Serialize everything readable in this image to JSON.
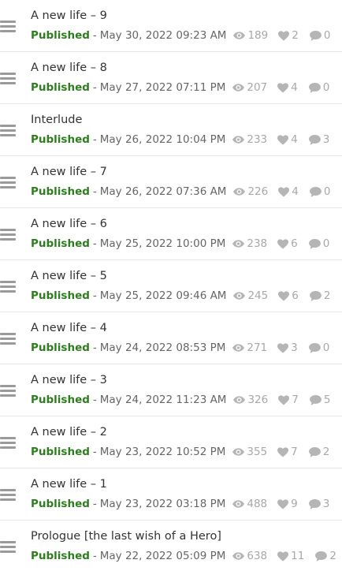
{
  "chapters": [
    {
      "title": "A new life – 9",
      "status": "Published",
      "date": "May 30, 2022 09:23 AM",
      "views": "189",
      "likes": "2",
      "comments": "0"
    },
    {
      "title": "A new life – 8",
      "status": "Published",
      "date": "May 27, 2022 07:11 PM",
      "views": "207",
      "likes": "4",
      "comments": "0"
    },
    {
      "title": "Interlude",
      "status": "Published",
      "date": "May 26, 2022 10:04 PM",
      "views": "233",
      "likes": "4",
      "comments": "3"
    },
    {
      "title": "A new life – 7",
      "status": "Published",
      "date": "May 26, 2022 07:36 AM",
      "views": "226",
      "likes": "4",
      "comments": "0"
    },
    {
      "title": "A new life – 6",
      "status": "Published",
      "date": "May 25, 2022 10:00 PM",
      "views": "238",
      "likes": "6",
      "comments": "0"
    },
    {
      "title": "A new life – 5",
      "status": "Published",
      "date": "May 25, 2022 09:46 AM",
      "views": "245",
      "likes": "6",
      "comments": "2"
    },
    {
      "title": "A new life – 4",
      "status": "Published",
      "date": "May 24, 2022 08:53 PM",
      "views": "271",
      "likes": "3",
      "comments": "0"
    },
    {
      "title": "A new life – 3",
      "status": "Published",
      "date": "May 24, 2022 11:23 AM",
      "views": "326",
      "likes": "7",
      "comments": "5"
    },
    {
      "title": "A new life – 2",
      "status": "Published",
      "date": "May 23, 2022 10:52 PM",
      "views": "355",
      "likes": "7",
      "comments": "2"
    },
    {
      "title": "A new life – 1",
      "status": "Published",
      "date": "May 23, 2022 03:18 PM",
      "views": "488",
      "likes": "9",
      "comments": "3"
    },
    {
      "title": "Prologue [the last wish of a Hero]",
      "status": "Published",
      "date": "May 22, 2022 05:09 PM",
      "views": "638",
      "likes": "11",
      "comments": "2"
    }
  ],
  "separator": "-",
  "icons": {
    "handle": "drag-handle-icon",
    "views": "eye-icon",
    "likes": "heart-icon",
    "comments": "comment-icon"
  },
  "colors": {
    "status": "#2e7d1f",
    "stat": "#a8a8a8",
    "handle": "#9a9a9a"
  }
}
